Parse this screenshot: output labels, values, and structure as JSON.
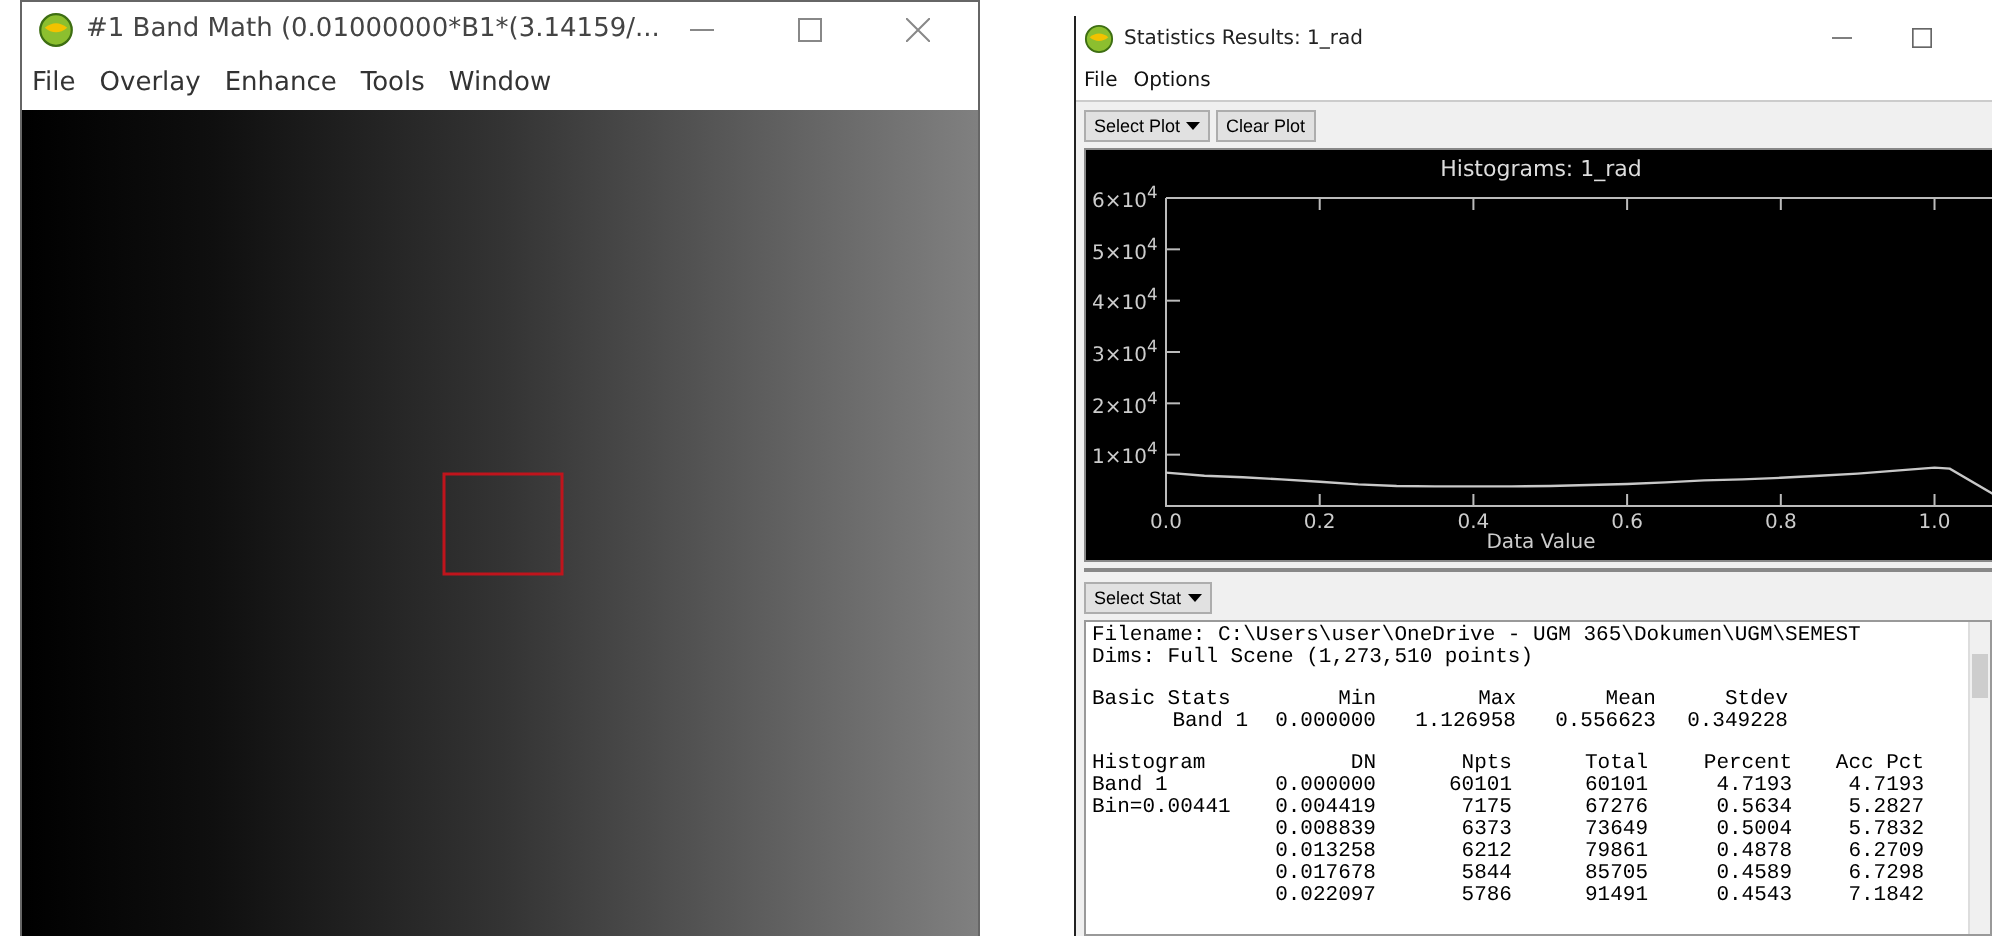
{
  "image_window": {
    "title": "#1 Band Math (0.01000000*B1*(3.14159/...",
    "menu": [
      "File",
      "Overlay",
      "Enhance",
      "Tools",
      "Window"
    ],
    "image": {
      "kind": "picture"
    }
  },
  "stats_window": {
    "title": "Statistics Results: 1_rad",
    "menu": [
      "File",
      "Options"
    ],
    "plot_buttons": [
      {
        "label": "Select Plot",
        "dropdown": true
      },
      {
        "label": "Clear Plot",
        "dropdown": false
      }
    ],
    "plot": {
      "chart_data": {
        "type": "line",
        "title": "Histograms: 1_rad",
        "xlabel": "Data Value",
        "x": [
          0,
          0.05,
          0.1,
          0.15,
          0.2,
          0.25,
          0.3,
          0.35,
          0.4,
          0.45,
          0.5,
          0.55,
          0.6,
          0.65,
          0.7,
          0.75,
          0.8,
          0.85,
          0.9,
          0.95,
          1.0,
          1.02,
          1.08
        ],
        "series": [
          {
            "color": "#c8c8c8",
            "values": [
              6500,
              5900,
              5600,
              5200,
              4700,
              4200,
              3900,
              3800,
              3800,
              3800,
              3900,
              4100,
              4300,
              4600,
              5000,
              5200,
              5500,
              5900,
              6300,
              6900,
              7500,
              7300,
              2000
            ]
          }
        ],
        "xlim": [
          0,
          1.08
        ],
        "ylim": [
          0,
          60000
        ],
        "xticks": [
          {
            "value": 0,
            "label": "0.0"
          },
          {
            "value": 0.2,
            "label": "0.2"
          },
          {
            "value": 0.4,
            "label": "0.4"
          },
          {
            "value": 0.6,
            "label": "0.6"
          },
          {
            "value": 0.8,
            "label": "0.8"
          },
          {
            "value": 1.0,
            "label": "1.0"
          }
        ],
        "yticks": [
          {
            "value": 10000,
            "label": "1×10$^{4}$"
          },
          {
            "value": 20000,
            "label": "2×10$^{4}$"
          },
          {
            "value": 30000,
            "label": "3×10$^{4}$"
          },
          {
            "value": 40000,
            "label": "4×10$^{4}$"
          },
          {
            "value": 50000,
            "label": "5×10$^{4}$"
          },
          {
            "value": 60000,
            "label": "6×10$^{4}$"
          }
        ]
      }
    },
    "stat_button": {
      "label": "Select Stat",
      "dropdown": true
    },
    "report": {
      "filename": "Filename: C:\\Users\\user\\OneDrive - UGM 365\\Dokumen\\UGM\\SEMEST",
      "dims": "Dims: Full Scene (1,273,510 points)",
      "basic": {
        "label": "Basic Stats",
        "columns": [
          "Min",
          "Max",
          "Mean",
          "Stdev"
        ],
        "rows": [
          {
            "label": "Band 1",
            "values": [
              "0.000000",
              "1.126958",
              "0.556623",
              "0.349228"
            ]
          }
        ]
      },
      "histogram": {
        "label": "Histogram",
        "columns": [
          "DN",
          "Npts",
          "Total",
          "Percent",
          "Acc Pct"
        ],
        "rows": [
          {
            "label": "Band 1",
            "values": [
              "0.000000",
              "60101",
              "60101",
              "4.7193",
              "4.7193"
            ]
          },
          {
            "label": "Bin=0.00441",
            "values": [
              "0.004419",
              "7175",
              "67276",
              "0.5634",
              "5.2827"
            ]
          },
          {
            "label": "",
            "values": [
              "0.008839",
              "6373",
              "73649",
              "0.5004",
              "5.7832"
            ]
          },
          {
            "label": "",
            "values": [
              "0.013258",
              "6212",
              "79861",
              "0.4878",
              "6.2709"
            ]
          },
          {
            "label": "",
            "values": [
              "0.017678",
              "5844",
              "85705",
              "0.4589",
              "6.7298"
            ]
          },
          {
            "label": "",
            "values": [
              "0.022097",
              "5786",
              "91491",
              "0.4543",
              "7.1842"
            ]
          }
        ]
      }
    }
  }
}
